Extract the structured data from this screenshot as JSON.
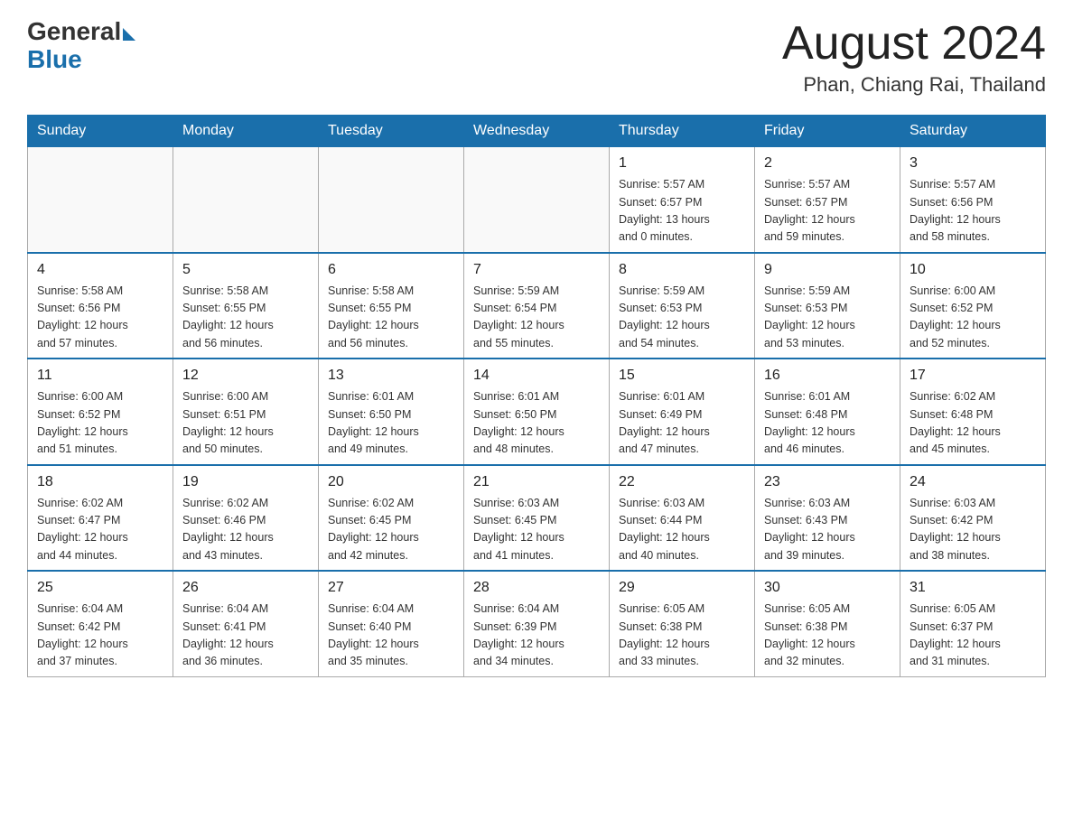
{
  "header": {
    "logo_general": "General",
    "logo_blue": "Blue",
    "month_title": "August 2024",
    "location": "Phan, Chiang Rai, Thailand"
  },
  "days_of_week": [
    "Sunday",
    "Monday",
    "Tuesday",
    "Wednesday",
    "Thursday",
    "Friday",
    "Saturday"
  ],
  "weeks": [
    [
      {
        "day": "",
        "info": ""
      },
      {
        "day": "",
        "info": ""
      },
      {
        "day": "",
        "info": ""
      },
      {
        "day": "",
        "info": ""
      },
      {
        "day": "1",
        "info": "Sunrise: 5:57 AM\nSunset: 6:57 PM\nDaylight: 13 hours\nand 0 minutes."
      },
      {
        "day": "2",
        "info": "Sunrise: 5:57 AM\nSunset: 6:57 PM\nDaylight: 12 hours\nand 59 minutes."
      },
      {
        "day": "3",
        "info": "Sunrise: 5:57 AM\nSunset: 6:56 PM\nDaylight: 12 hours\nand 58 minutes."
      }
    ],
    [
      {
        "day": "4",
        "info": "Sunrise: 5:58 AM\nSunset: 6:56 PM\nDaylight: 12 hours\nand 57 minutes."
      },
      {
        "day": "5",
        "info": "Sunrise: 5:58 AM\nSunset: 6:55 PM\nDaylight: 12 hours\nand 56 minutes."
      },
      {
        "day": "6",
        "info": "Sunrise: 5:58 AM\nSunset: 6:55 PM\nDaylight: 12 hours\nand 56 minutes."
      },
      {
        "day": "7",
        "info": "Sunrise: 5:59 AM\nSunset: 6:54 PM\nDaylight: 12 hours\nand 55 minutes."
      },
      {
        "day": "8",
        "info": "Sunrise: 5:59 AM\nSunset: 6:53 PM\nDaylight: 12 hours\nand 54 minutes."
      },
      {
        "day": "9",
        "info": "Sunrise: 5:59 AM\nSunset: 6:53 PM\nDaylight: 12 hours\nand 53 minutes."
      },
      {
        "day": "10",
        "info": "Sunrise: 6:00 AM\nSunset: 6:52 PM\nDaylight: 12 hours\nand 52 minutes."
      }
    ],
    [
      {
        "day": "11",
        "info": "Sunrise: 6:00 AM\nSunset: 6:52 PM\nDaylight: 12 hours\nand 51 minutes."
      },
      {
        "day": "12",
        "info": "Sunrise: 6:00 AM\nSunset: 6:51 PM\nDaylight: 12 hours\nand 50 minutes."
      },
      {
        "day": "13",
        "info": "Sunrise: 6:01 AM\nSunset: 6:50 PM\nDaylight: 12 hours\nand 49 minutes."
      },
      {
        "day": "14",
        "info": "Sunrise: 6:01 AM\nSunset: 6:50 PM\nDaylight: 12 hours\nand 48 minutes."
      },
      {
        "day": "15",
        "info": "Sunrise: 6:01 AM\nSunset: 6:49 PM\nDaylight: 12 hours\nand 47 minutes."
      },
      {
        "day": "16",
        "info": "Sunrise: 6:01 AM\nSunset: 6:48 PM\nDaylight: 12 hours\nand 46 minutes."
      },
      {
        "day": "17",
        "info": "Sunrise: 6:02 AM\nSunset: 6:48 PM\nDaylight: 12 hours\nand 45 minutes."
      }
    ],
    [
      {
        "day": "18",
        "info": "Sunrise: 6:02 AM\nSunset: 6:47 PM\nDaylight: 12 hours\nand 44 minutes."
      },
      {
        "day": "19",
        "info": "Sunrise: 6:02 AM\nSunset: 6:46 PM\nDaylight: 12 hours\nand 43 minutes."
      },
      {
        "day": "20",
        "info": "Sunrise: 6:02 AM\nSunset: 6:45 PM\nDaylight: 12 hours\nand 42 minutes."
      },
      {
        "day": "21",
        "info": "Sunrise: 6:03 AM\nSunset: 6:45 PM\nDaylight: 12 hours\nand 41 minutes."
      },
      {
        "day": "22",
        "info": "Sunrise: 6:03 AM\nSunset: 6:44 PM\nDaylight: 12 hours\nand 40 minutes."
      },
      {
        "day": "23",
        "info": "Sunrise: 6:03 AM\nSunset: 6:43 PM\nDaylight: 12 hours\nand 39 minutes."
      },
      {
        "day": "24",
        "info": "Sunrise: 6:03 AM\nSunset: 6:42 PM\nDaylight: 12 hours\nand 38 minutes."
      }
    ],
    [
      {
        "day": "25",
        "info": "Sunrise: 6:04 AM\nSunset: 6:42 PM\nDaylight: 12 hours\nand 37 minutes."
      },
      {
        "day": "26",
        "info": "Sunrise: 6:04 AM\nSunset: 6:41 PM\nDaylight: 12 hours\nand 36 minutes."
      },
      {
        "day": "27",
        "info": "Sunrise: 6:04 AM\nSunset: 6:40 PM\nDaylight: 12 hours\nand 35 minutes."
      },
      {
        "day": "28",
        "info": "Sunrise: 6:04 AM\nSunset: 6:39 PM\nDaylight: 12 hours\nand 34 minutes."
      },
      {
        "day": "29",
        "info": "Sunrise: 6:05 AM\nSunset: 6:38 PM\nDaylight: 12 hours\nand 33 minutes."
      },
      {
        "day": "30",
        "info": "Sunrise: 6:05 AM\nSunset: 6:38 PM\nDaylight: 12 hours\nand 32 minutes."
      },
      {
        "day": "31",
        "info": "Sunrise: 6:05 AM\nSunset: 6:37 PM\nDaylight: 12 hours\nand 31 minutes."
      }
    ]
  ]
}
